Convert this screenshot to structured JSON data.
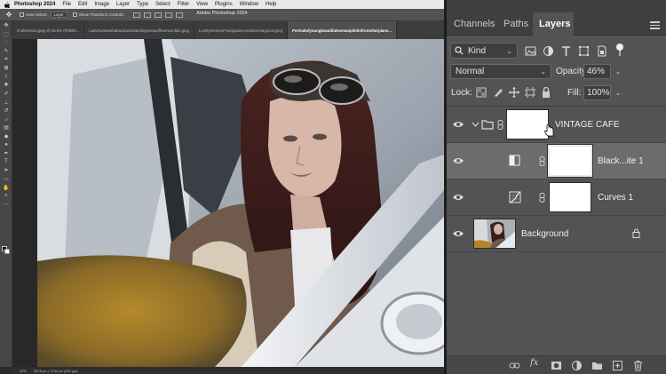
{
  "menubar": {
    "apple": "",
    "app": "Photoshop 2024",
    "items": [
      "File",
      "Edit",
      "Image",
      "Layer",
      "Type",
      "Select",
      "Filter",
      "View",
      "Plugins",
      "Window",
      "Help"
    ]
  },
  "options_bar": {
    "auto_select_label": "Auto-Select:",
    "auto_select_value": "Layer",
    "show_transform_label": "Show Transform Controls",
    "window_title": "Adobe Photoshop 2024"
  },
  "document_tabs": [
    "tFullWoman.jpeg @ 46.8% (RGB/8...",
    "Ladytouristwithabackpackstandingontopofthemountain.jpeg",
    "LovelyWomanPosingandAroundaVintageCar.jpeg",
    "Portraitofyoungbeautifulwomanpilotinfrontofairplane..."
  ],
  "status_bar": {
    "zoom": "50%",
    "doc_size": "5616 px x 3744 px (300 ppi)"
  },
  "panel": {
    "tabs": [
      "Channels",
      "Paths",
      "Layers"
    ],
    "active_tab": "Layers",
    "filter_kind": "Kind",
    "blend_mode": "Normal",
    "opacity_label": "Opacity:",
    "opacity_value": "46%",
    "lock_label": "Lock:",
    "fill_label": "Fill:",
    "fill_value": "100%",
    "layers": [
      {
        "name": "VINTAGE CAFE",
        "type": "group",
        "visible": true
      },
      {
        "name": "Black...ite 1",
        "type": "adjustment-black-white",
        "visible": true,
        "selected": true
      },
      {
        "name": "Curves 1",
        "type": "adjustment-curves",
        "visible": true
      },
      {
        "name": "Background",
        "type": "image",
        "visible": true,
        "locked": true
      }
    ]
  },
  "colors": {
    "panel_bg": "#535353",
    "selected_layer": "#6c6c6c",
    "tab_bar": "#3f3f3f",
    "menubar": "#e9e9e9"
  }
}
